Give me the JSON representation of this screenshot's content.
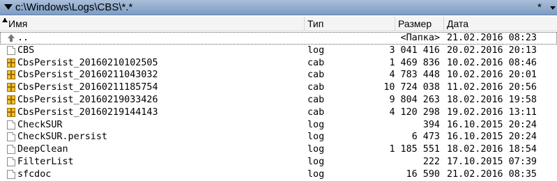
{
  "path_bar": {
    "path": "c:\\Windows\\Logs\\CBS\\*.*",
    "star": "*"
  },
  "columns": {
    "name": "Имя",
    "type": "Тип",
    "size": "Размер",
    "date": "Дата"
  },
  "files": [
    {
      "name": "..",
      "type": "",
      "size": "<Папка>",
      "date": "21.02.2016 08:23",
      "icon": "up-dir-icon"
    },
    {
      "name": "CBS",
      "type": "log",
      "size": "3 041 416",
      "date": "20.02.2016 20:13",
      "icon": "document-icon"
    },
    {
      "name": "CbsPersist_20160210102505",
      "type": "cab",
      "size": "1 469 836",
      "date": "10.02.2016 08:46",
      "icon": "cab-archive-icon"
    },
    {
      "name": "CbsPersist_20160211043032",
      "type": "cab",
      "size": "4 783 448",
      "date": "10.02.2016 20:01",
      "icon": "cab-archive-icon"
    },
    {
      "name": "CbsPersist_20160211185754",
      "type": "cab",
      "size": "10 724 038",
      "date": "11.02.2016 20:56",
      "icon": "cab-archive-icon"
    },
    {
      "name": "CbsPersist_20160219033426",
      "type": "cab",
      "size": "9 804 263",
      "date": "18.02.2016 19:58",
      "icon": "cab-archive-icon"
    },
    {
      "name": "CbsPersist_20160219144143",
      "type": "cab",
      "size": "4 120 298",
      "date": "19.02.2016 13:11",
      "icon": "cab-archive-icon"
    },
    {
      "name": "CheckSUR",
      "type": "log",
      "size": "394",
      "date": "16.10.2015 20:24",
      "icon": "document-icon"
    },
    {
      "name": "CheckSUR.persist",
      "type": "log",
      "size": "6 473",
      "date": "16.10.2015 20:24",
      "icon": "document-icon"
    },
    {
      "name": "DeepClean",
      "type": "log",
      "size": "1 185 551",
      "date": "18.02.2016 18:54",
      "icon": "document-icon"
    },
    {
      "name": "FilterList",
      "type": "log",
      "size": "222",
      "date": "17.10.2015 07:39",
      "icon": "document-icon"
    },
    {
      "name": "sfcdoc",
      "type": "log",
      "size": "16 590",
      "date": "21.02.2016 08:35",
      "icon": "document-icon"
    }
  ]
}
